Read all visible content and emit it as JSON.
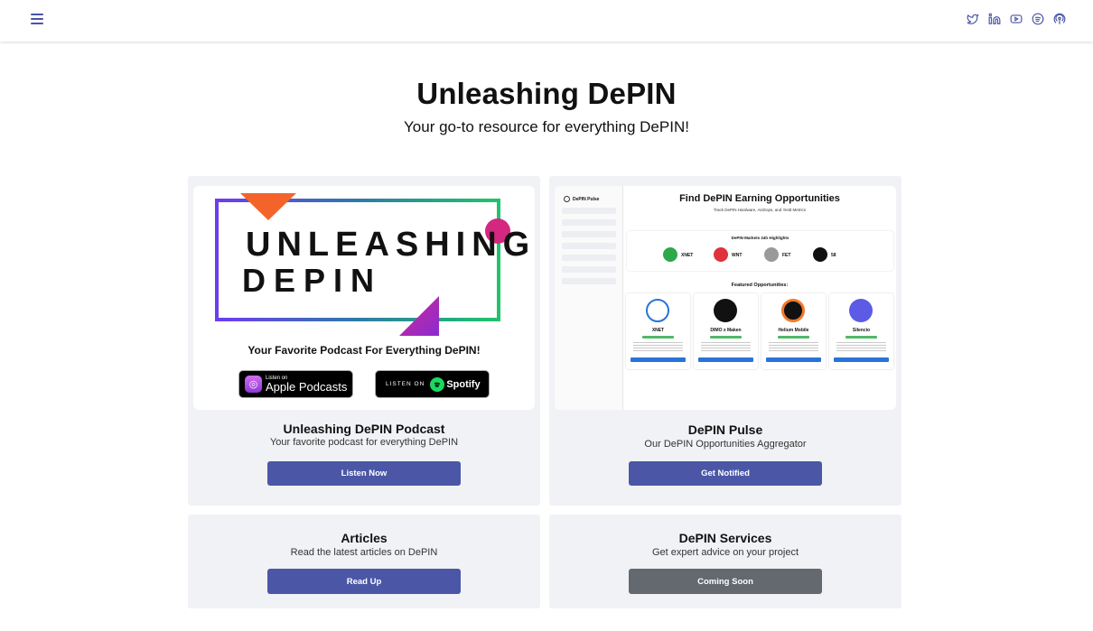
{
  "header": {
    "menu_icon": "hamburger-menu-icon",
    "socials": [
      "twitter-icon",
      "linkedin-icon",
      "youtube-icon",
      "spotify-icon",
      "podcast-icon"
    ]
  },
  "hero": {
    "title": "Unleashing DePIN",
    "subtitle": "Your go-to resource for everything DePIN!"
  },
  "cards": {
    "podcast": {
      "title": "Unleashing DePIN Podcast",
      "subtitle": "Your favorite podcast for everything DePIN",
      "button": "Listen Now",
      "art": {
        "word1": "UNLEASHING",
        "word2": "DEPIN",
        "tagline": "Your Favorite Podcast For Everything DePIN!",
        "apple_small": "Listen on",
        "apple_big": "Apple Podcasts",
        "spotify_small": "LISTEN ON",
        "spotify_big": "Spotify"
      }
    },
    "pulse": {
      "title": "DePIN Pulse",
      "subtitle": "Our DePIN Opportunities Aggregator",
      "button": "Get Notified",
      "preview": {
        "brand": "DePIN Pulse",
        "heading": "Find DePIN Earning Opportunities",
        "subheading": "Track DePIN Hardware, Airdrops, and Yield Metrics",
        "highlights_title": "DePIN Markets 24h Highlights",
        "highlight_labels": [
          "XNET",
          "WNT",
          "FET",
          "58"
        ],
        "featured_title": "Featured Opportunities:",
        "featured": [
          "XNET",
          "DIMO x Maken",
          "Helium Mobile",
          "Silencio"
        ]
      }
    },
    "articles": {
      "title": "Articles",
      "subtitle": "Read the latest articles on DePIN",
      "button": "Read Up"
    },
    "services": {
      "title": "DePIN Services",
      "subtitle": "Get expert advice on your project",
      "button": "Coming Soon"
    }
  },
  "colors": {
    "accent": "#4b57a6",
    "disabled": "#64686f",
    "card_bg": "#f1f2f5"
  }
}
